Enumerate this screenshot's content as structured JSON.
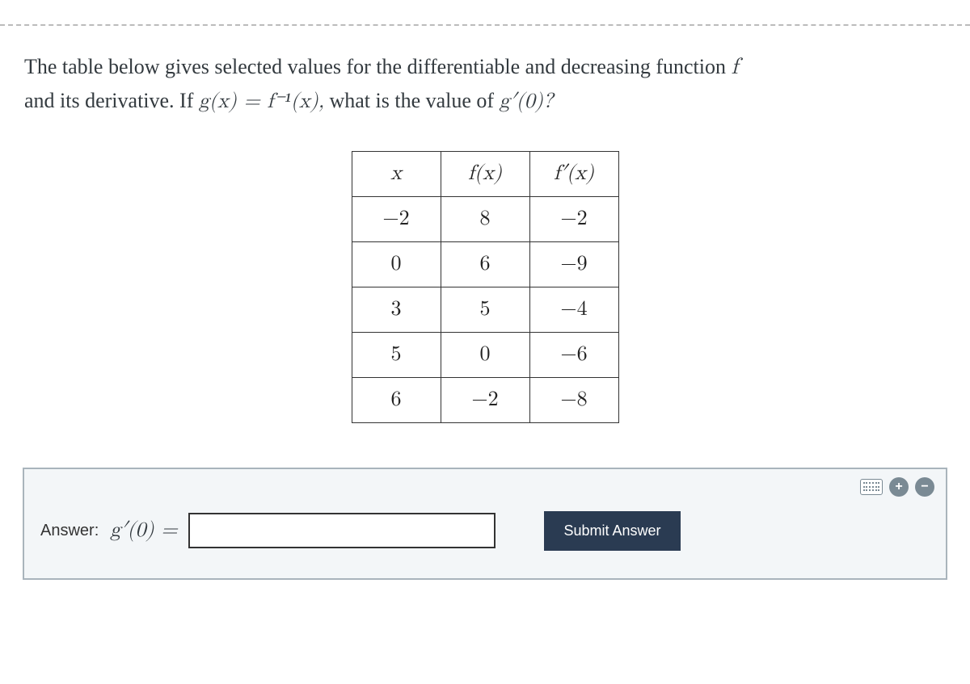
{
  "question": {
    "line1_pre": "The table below gives selected values for the differentiable and decreasing function ",
    "line1_f": "f",
    "line2_pre": "and its derivative. If ",
    "line2_eq": "g(x) = f⁻¹(x),",
    "line2_post": " what is the value of ",
    "line2_g": "g′(0)?"
  },
  "table": {
    "headers": {
      "c1": "x",
      "c2": "f(x)",
      "c3": "f′(x)"
    },
    "rows": [
      {
        "c1": "−2",
        "c2": "8",
        "c3": "−2"
      },
      {
        "c1": "0",
        "c2": "6",
        "c3": "−9"
      },
      {
        "c1": "3",
        "c2": "5",
        "c3": "−4"
      },
      {
        "c1": "5",
        "c2": "0",
        "c3": "−6"
      },
      {
        "c1": "6",
        "c2": "−2",
        "c3": "−8"
      }
    ]
  },
  "answer": {
    "label": "Answer:",
    "expr": "g′(0) =",
    "value": "",
    "submit": "Submit Answer"
  },
  "icons": {
    "plus": "+",
    "minus": "−"
  }
}
